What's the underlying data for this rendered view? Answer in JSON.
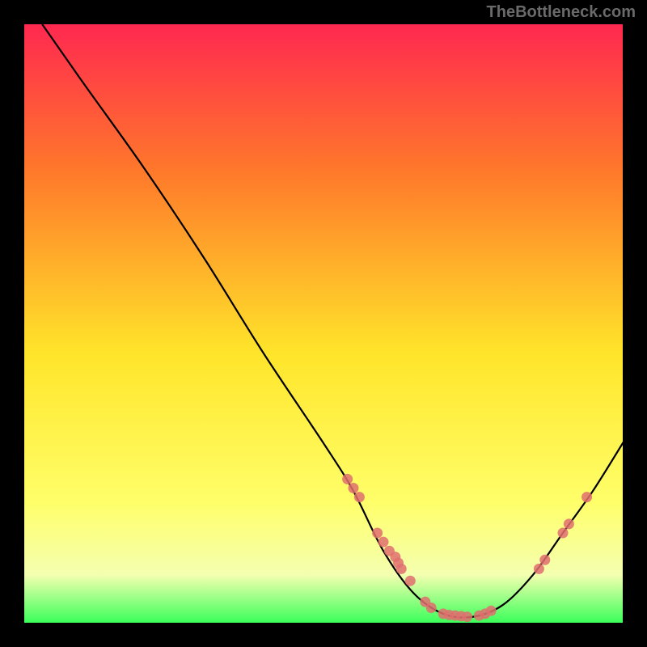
{
  "watermark": "TheBottleneck.com",
  "chart_data": {
    "type": "line",
    "title": "",
    "xlabel": "",
    "ylabel": "",
    "xlim": [
      0,
      100
    ],
    "ylim": [
      0,
      100
    ],
    "gradient_colors": {
      "top": "#ff2850",
      "mid_upper": "#ff7a2a",
      "mid": "#ffe52a",
      "mid_lower": "#ffff6a",
      "bottom": "#3aff5a"
    },
    "curve": [
      {
        "x": 3,
        "y": 100
      },
      {
        "x": 10,
        "y": 90
      },
      {
        "x": 20,
        "y": 76
      },
      {
        "x": 30,
        "y": 61
      },
      {
        "x": 40,
        "y": 45
      },
      {
        "x": 50,
        "y": 30
      },
      {
        "x": 55,
        "y": 22
      },
      {
        "x": 60,
        "y": 12
      },
      {
        "x": 65,
        "y": 5
      },
      {
        "x": 70,
        "y": 1.5
      },
      {
        "x": 75,
        "y": 1
      },
      {
        "x": 80,
        "y": 3
      },
      {
        "x": 85,
        "y": 8
      },
      {
        "x": 90,
        "y": 15
      },
      {
        "x": 95,
        "y": 22
      },
      {
        "x": 100,
        "y": 30
      }
    ],
    "markers": [
      {
        "x": 54,
        "y": 24
      },
      {
        "x": 55,
        "y": 22.5
      },
      {
        "x": 56,
        "y": 21
      },
      {
        "x": 59,
        "y": 15
      },
      {
        "x": 60,
        "y": 13.5
      },
      {
        "x": 61,
        "y": 12
      },
      {
        "x": 62,
        "y": 11
      },
      {
        "x": 62.5,
        "y": 10
      },
      {
        "x": 63,
        "y": 9
      },
      {
        "x": 64.5,
        "y": 7
      },
      {
        "x": 67,
        "y": 3.5
      },
      {
        "x": 68,
        "y": 2.5
      },
      {
        "x": 70,
        "y": 1.5
      },
      {
        "x": 71,
        "y": 1.3
      },
      {
        "x": 72,
        "y": 1.2
      },
      {
        "x": 73,
        "y": 1.1
      },
      {
        "x": 74,
        "y": 1.0
      },
      {
        "x": 76,
        "y": 1.2
      },
      {
        "x": 77,
        "y": 1.5
      },
      {
        "x": 78,
        "y": 2
      },
      {
        "x": 86,
        "y": 9
      },
      {
        "x": 87,
        "y": 10.5
      },
      {
        "x": 90,
        "y": 15
      },
      {
        "x": 91,
        "y": 16.5
      },
      {
        "x": 94,
        "y": 21
      }
    ]
  }
}
